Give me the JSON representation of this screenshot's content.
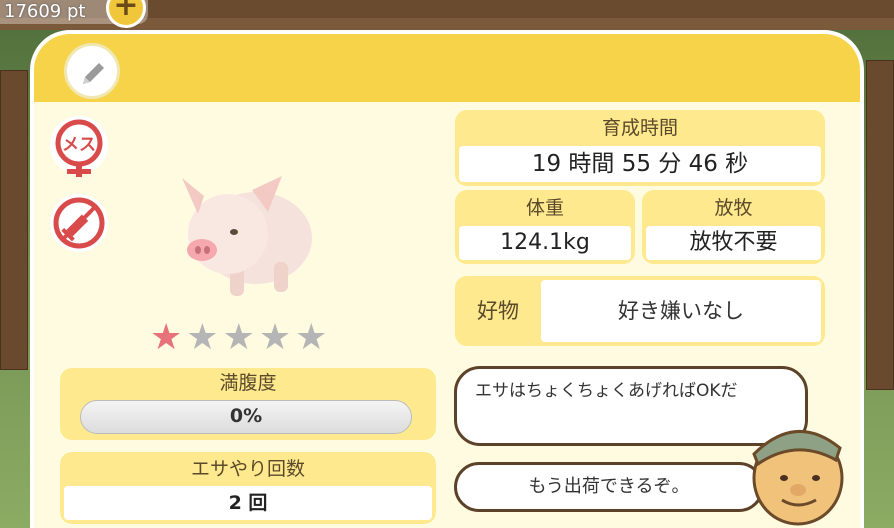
{
  "points": {
    "value": "17609 pt",
    "add_label": "+"
  },
  "header": {
    "edit_icon": "pencil-icon"
  },
  "badges": [
    {
      "icon": "female-symbol-icon",
      "label": "メス"
    },
    {
      "icon": "syringe-icon"
    }
  ],
  "animal": {
    "icon": "pig-icon",
    "rating": 1,
    "rating_max": 5
  },
  "stats": {
    "raising_time": {
      "label": "育成時間",
      "value": "19 時間 55 分 46 秒"
    },
    "weight": {
      "label": "体重",
      "value": "124.1kg"
    },
    "grazing": {
      "label": "放牧",
      "value": "放牧不要"
    },
    "favorite": {
      "label": "好物",
      "value": "好き嫌いなし"
    },
    "fullness": {
      "label": "満腹度",
      "value": "0%",
      "fraction": 0.0
    },
    "feed_count": {
      "label": "エサやり回数",
      "value": "2 回"
    }
  },
  "dialog": {
    "bubble1": "エサはちょくちょくあげればOKだ",
    "bubble2": "もう出荷できるぞ。"
  },
  "colors": {
    "header": "#f7d34a",
    "panel": "#fffbe0",
    "label_box": "#ffe98e",
    "badge_red": "#d94a4a",
    "star_on": "#e8727a",
    "star_off": "#b5b5b5"
  }
}
